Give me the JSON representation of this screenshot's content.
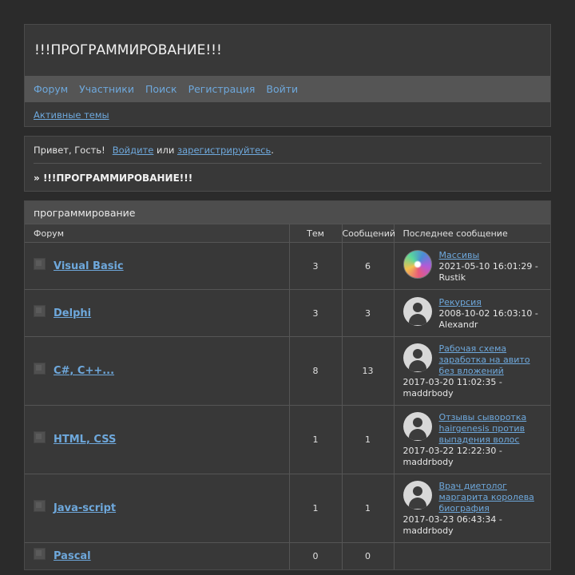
{
  "header": {
    "title": "!!!ПРОГРАММИРОВАНИЕ!!!",
    "nav": [
      "Форум",
      "Участники",
      "Поиск",
      "Регистрация",
      "Войти"
    ],
    "active_topics": "Активные темы"
  },
  "welcome": {
    "greeting": "Привет, Гость!",
    "login": "Войдите",
    "or": "или",
    "register": "зарегистрируйтесь",
    "dot": ".",
    "crumb_prefix": "»",
    "crumb": "!!!ПРОГРАММИРОВАНИЕ!!!"
  },
  "category": {
    "name": "программирование",
    "columns": {
      "forum": "Форум",
      "topics": "Тем",
      "posts": "Сообщений",
      "last": "Последнее сообщение"
    },
    "forums": [
      {
        "name": "Visual Basic",
        "topics": "3",
        "posts": "6",
        "last_title": "Массивы",
        "last_date": "2021-05-10 16:01:29 -",
        "last_user": "Rustik",
        "avatar": "swirl-avatar"
      },
      {
        "name": "Delphi",
        "topics": "3",
        "posts": "3",
        "last_title": "Рекурсия",
        "last_date": "2008-10-02 16:03:10 -",
        "last_user": "Alexandr",
        "avatar": "default-avatar"
      },
      {
        "name": "C#, C++...",
        "topics": "8",
        "posts": "13",
        "last_title": "Рабочая схема заработка на авито без вложений",
        "last_date": "2017-03-20 11:02:35 -",
        "last_user": "maddrbody",
        "avatar": "default-avatar"
      },
      {
        "name": "HTML, CSS",
        "topics": "1",
        "posts": "1",
        "last_title": "Отзывы сыворотка hairgenesis против выпадения волос",
        "last_date": "2017-03-22 12:22:30 -",
        "last_user": "maddrbody",
        "avatar": "default-avatar"
      },
      {
        "name": "Java-script",
        "topics": "1",
        "posts": "1",
        "last_title": "Врач диетолог маргарита королева биография",
        "last_date": "2017-03-23 06:43:34 -",
        "last_user": "maddrbody",
        "avatar": "default-avatar"
      },
      {
        "name": "Pascal",
        "topics": "0",
        "posts": "0",
        "last_title": "",
        "last_date": "",
        "last_user": "",
        "avatar": ""
      }
    ]
  }
}
